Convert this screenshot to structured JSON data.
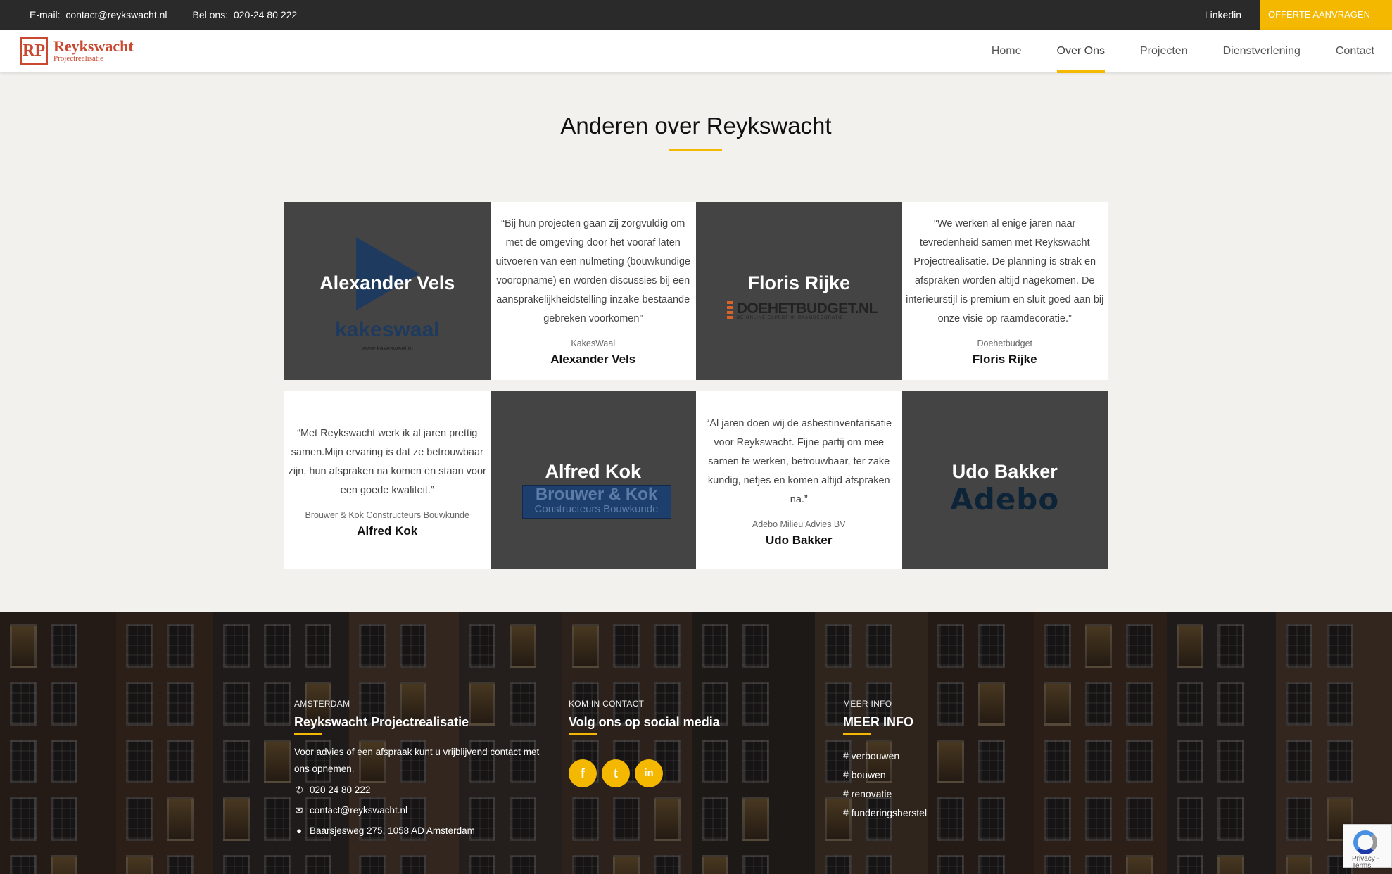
{
  "topbar": {
    "email_label": "E-mail:",
    "email": "contact@reykswacht.nl",
    "phone_label": "Bel ons:",
    "phone": "020-24 80 222",
    "linkedin": "Linkedin",
    "offerte": "OFFERTE AANVRAGEN"
  },
  "logo": {
    "mark": "RP",
    "name": "Reykswacht",
    "sub": "Projectrealisatie"
  },
  "nav": {
    "items": [
      "Home",
      "Over Ons",
      "Projecten",
      "Dienstverlening",
      "Contact"
    ],
    "active": "Over Ons"
  },
  "section": {
    "title": "Anderen over Reykswacht"
  },
  "testimonials": [
    {
      "image_name": "Alexander Vels",
      "logo_text": "kakeswaal",
      "logo_url": "www.kakeswaal.nl",
      "quote": "“Bij hun projecten gaan zij zorgvuldig om met de omgeving door het vooraf laten uitvoeren van een nulmeting (bouwkundige vooropname) en worden discussies bij een aansprakelijkheidstelling inzake bestaande gebreken voorkomen”",
      "company": "KakesWaal",
      "person": "Alexander Vels"
    },
    {
      "image_name": "Floris Rijke",
      "logo_text": "DOEHETBUDGET.NL",
      "logo_sub": "DE ONLINE EXPERT IN RAAMDECORATIE",
      "quote": "“We werken al enige jaren naar tevredenheid samen met Reykswacht Projectrealisatie. De planning is strak en afspraken worden altijd nagekomen. De interieurstijl is premium en sluit goed aan bij onze visie op raamdecoratie.”",
      "company": "Doehetbudget",
      "person": "Floris Rijke"
    },
    {
      "image_name": "Alfred Kok",
      "logo_text_a": "Brouwer & Kok",
      "logo_text_b": "Constructeurs Bouwkunde",
      "quote": "“Met Reykswacht werk ik al jaren prettig samen.Mijn ervaring is dat ze betrouwbaar zijn, hun afspraken na komen en staan voor een goede kwaliteit.”",
      "company": "Brouwer & Kok Constructeurs Bouwkunde",
      "person": "Alfred Kok"
    },
    {
      "image_name": "Udo Bakker",
      "logo_text": "Adebo",
      "quote": "“Al jaren doen wij de asbestinventarisatie voor Reykswacht. Fijne partij om mee samen te werken, betrouwbaar, ter zake kundig, netjes en komen altijd afspraken na.”",
      "company": "Adebo Milieu Advies BV",
      "person": "Udo Bakker"
    }
  ],
  "footer": {
    "col1": {
      "kicker": "AMSTERDAM",
      "title": "Reykswacht Projectrealisatie",
      "text": "Voor advies of een afspraak kunt u vrijblijvend contact met ons opnemen.",
      "phone": "020 24 80 222",
      "email": "contact@reykswacht.nl",
      "address": "Baarsjesweg 275, 1058 AD Amsterdam"
    },
    "col2": {
      "kicker": "KOM IN CONTACT",
      "title": "Volg ons op social media",
      "socials": [
        "f",
        "t",
        "in"
      ]
    },
    "col3": {
      "kicker": "MEER INFO",
      "title": "MEER INFO",
      "tags": [
        "# verbouwen",
        "# bouwen",
        "# renovatie",
        "# funderingsherstel"
      ]
    }
  },
  "recaptcha": {
    "text": "Privacy - Terms"
  },
  "icons": {
    "phone": "phone-icon",
    "mail": "mail-icon",
    "pin": "map-pin-icon",
    "facebook": "facebook-icon",
    "twitter": "twitter-icon",
    "linkedin": "linkedin-icon"
  },
  "colors": {
    "accent": "#f5b800",
    "brand": "#c9482f",
    "topbar": "#2a2a2a",
    "tile": "#444444"
  }
}
